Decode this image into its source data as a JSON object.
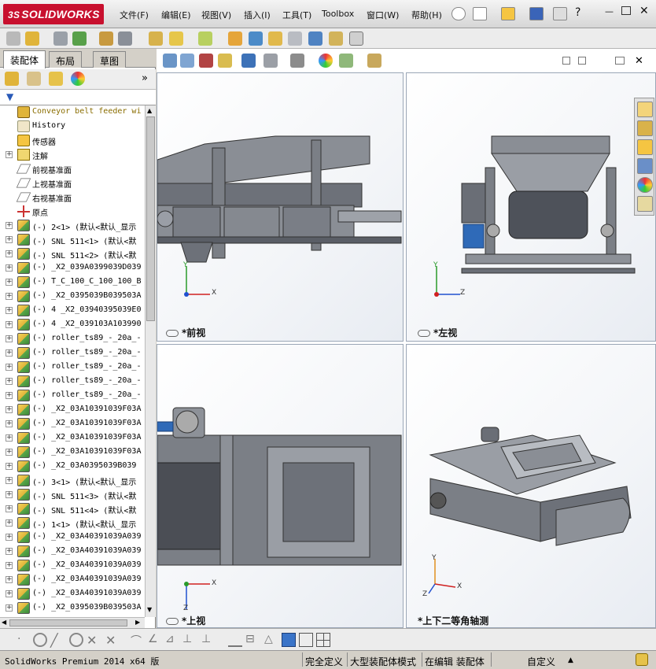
{
  "app": {
    "logo_text": "SOLIDWORKS",
    "brand_color": "#c8102e"
  },
  "menu": [
    {
      "label": "文件(F)"
    },
    {
      "label": "编辑(E)"
    },
    {
      "label": "视图(V)"
    },
    {
      "label": "插入(I)"
    },
    {
      "label": "工具(T)"
    },
    {
      "label": "Toolbox"
    },
    {
      "label": "窗口(W)"
    },
    {
      "label": "帮助(H)"
    }
  ],
  "panel": {
    "tabs": [
      {
        "label": "装配体"
      },
      {
        "label": "布局"
      },
      {
        "label": "草图"
      }
    ],
    "tree": [
      {
        "label": "Conveyor belt feeder wi",
        "icon": "assembly-warning-icon",
        "expand": "",
        "color": "#8a6d00"
      },
      {
        "label": "History",
        "icon": "history-icon",
        "expand": "",
        "color": "#000"
      },
      {
        "label": "传感器",
        "icon": "sensor-icon",
        "expand": "",
        "color": "#000"
      },
      {
        "label": "注解",
        "icon": "annotation-icon",
        "expand": "+",
        "color": "#000"
      },
      {
        "label": "前视基准面",
        "icon": "plane-icon",
        "expand": "",
        "color": "#000"
      },
      {
        "label": "上视基准面",
        "icon": "plane-icon",
        "expand": "",
        "color": "#000"
      },
      {
        "label": "右视基准面",
        "icon": "plane-icon",
        "expand": "",
        "color": "#000"
      },
      {
        "label": "原点",
        "icon": "origin-icon",
        "expand": "",
        "color": "#000"
      },
      {
        "label": "(-) 2<1> (默认<默认_显示",
        "icon": "subassembly-icon",
        "expand": "+",
        "color": "#000"
      },
      {
        "label": "(-) SNL 511<1> (默认<默",
        "icon": "subassembly-icon",
        "expand": "+",
        "color": "#000"
      },
      {
        "label": "(-) SNL 511<2> (默认<默",
        "icon": "subassembly-icon",
        "expand": "+",
        "color": "#000"
      },
      {
        "label": "(-) _X2_039A0399039D039",
        "icon": "subassembly-icon",
        "expand": "+",
        "color": "#000"
      },
      {
        "label": "(-) T_C_100_C_100_100_B",
        "icon": "subassembly-icon",
        "expand": "+",
        "color": "#000"
      },
      {
        "label": "(-) _X2_0395039B039503A",
        "icon": "subassembly-icon",
        "expand": "+",
        "color": "#000"
      },
      {
        "label": "(-) 4 _X2_03940395039E0",
        "icon": "subassembly-icon",
        "expand": "+",
        "color": "#000"
      },
      {
        "label": "(-) 4 _X2_039103A103990",
        "icon": "subassembly-icon",
        "expand": "+",
        "color": "#000"
      },
      {
        "label": "(-) roller_ts89_-_20a_-",
        "icon": "subassembly-icon",
        "expand": "+",
        "color": "#000"
      },
      {
        "label": "(-) roller_ts89_-_20a_-",
        "icon": "subassembly-icon",
        "expand": "+",
        "color": "#000"
      },
      {
        "label": "(-) roller_ts89_-_20a_-",
        "icon": "subassembly-icon",
        "expand": "+",
        "color": "#000"
      },
      {
        "label": "(-) roller_ts89_-_20a_-",
        "icon": "subassembly-icon",
        "expand": "+",
        "color": "#000"
      },
      {
        "label": "(-) roller_ts89_-_20a_-",
        "icon": "subassembly-icon",
        "expand": "+",
        "color": "#000"
      },
      {
        "label": "(-) _X2_03A10391039F03A",
        "icon": "subassembly-icon",
        "expand": "+",
        "color": "#000"
      },
      {
        "label": "(-) _X2_03A10391039F03A",
        "icon": "subassembly-icon",
        "expand": "+",
        "color": "#000"
      },
      {
        "label": "(-) _X2_03A10391039F03A",
        "icon": "subassembly-icon",
        "expand": "+",
        "color": "#000"
      },
      {
        "label": "(-) _X2_03A10391039F03A",
        "icon": "subassembly-icon",
        "expand": "+",
        "color": "#000"
      },
      {
        "label": "(-) _X2_03A0395039B039",
        "icon": "subassembly-icon",
        "expand": "+",
        "color": "#000"
      },
      {
        "label": "(-) 3<1> (默认<默认_显示",
        "icon": "subassembly-icon",
        "expand": "+",
        "color": "#000"
      },
      {
        "label": "(-) SNL 511<3> (默认<默",
        "icon": "subassembly-icon",
        "expand": "+",
        "color": "#000"
      },
      {
        "label": "(-) SNL 511<4> (默认<默",
        "icon": "subassembly-icon",
        "expand": "+",
        "color": "#000"
      },
      {
        "label": "(-) 1<1> (默认<默认_显示",
        "icon": "subassembly-icon",
        "expand": "+",
        "color": "#000"
      },
      {
        "label": "(-) _X2_03A40391039A039",
        "icon": "subassembly-icon",
        "expand": "+",
        "color": "#000"
      },
      {
        "label": "(-) _X2_03A40391039A039",
        "icon": "subassembly-icon",
        "expand": "+",
        "color": "#000"
      },
      {
        "label": "(-) _X2_03A40391039A039",
        "icon": "subassembly-icon",
        "expand": "+",
        "color": "#000"
      },
      {
        "label": "(-) _X2_03A40391039A039",
        "icon": "subassembly-icon",
        "expand": "+",
        "color": "#000"
      },
      {
        "label": "(-) _X2_03A40391039A039",
        "icon": "subassembly-icon",
        "expand": "+",
        "color": "#000"
      },
      {
        "label": "(-) _X2_0395039B039503A",
        "icon": "subassembly-icon",
        "expand": "+",
        "color": "#000"
      }
    ]
  },
  "views": [
    {
      "label": "*前视",
      "axis_a": "Y",
      "axis_b": "X"
    },
    {
      "label": "*左视",
      "axis_a": "Y",
      "axis_b": "Z"
    },
    {
      "label": "*上视",
      "axis_a": "X",
      "axis_b": "Z"
    },
    {
      "label": "*上下二等角轴测",
      "axis_a": "Y",
      "axis_b": "X"
    }
  ],
  "iso_axis_z": "Z",
  "status": {
    "product": "SolidWorks Premium 2014 x64 版",
    "definition": "完全定义",
    "mode": "大型装配体模式",
    "editing": "在编辑 装配体",
    "custom": "自定义"
  },
  "colors": {
    "axis_y": "#2a9a2a",
    "axis_x": "#d02020",
    "axis_z": "#2050d0",
    "model_gray": "#7b7f86",
    "model_dark": "#4b4e55"
  }
}
